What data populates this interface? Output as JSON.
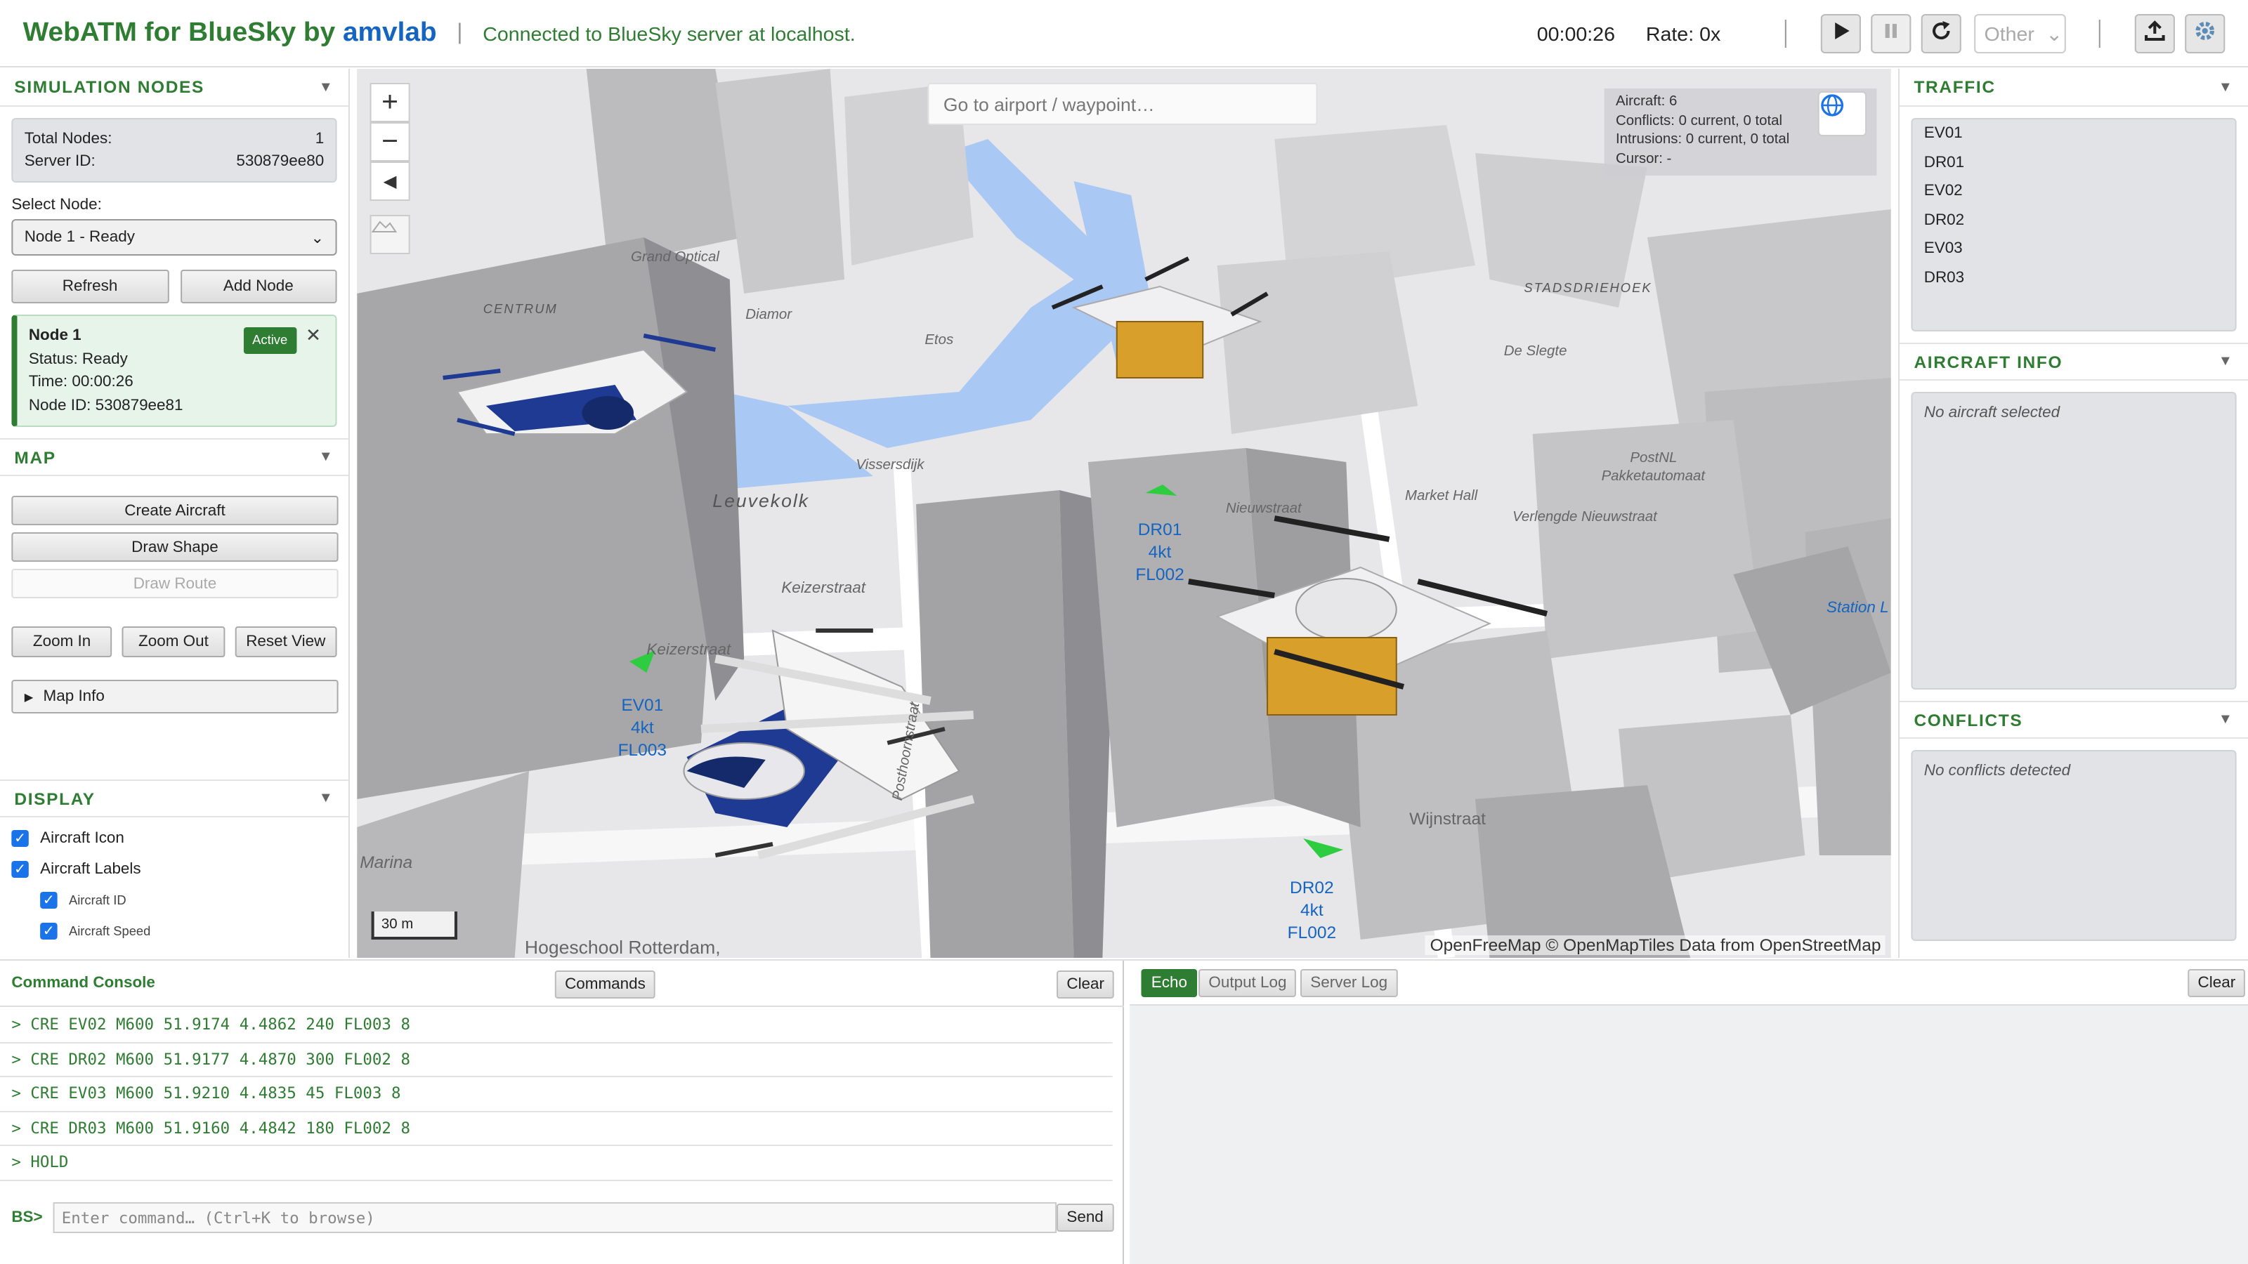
{
  "header": {
    "brand": "WebATM for BlueSky by",
    "brand_highlight": "amvlab",
    "separator": "|",
    "connection": "Connected to BlueSky server at localhost.",
    "sim_time": "00:00:26",
    "rate": "Rate: 0x",
    "other_select": "Other"
  },
  "left": {
    "sim_nodes": {
      "title": "SIMULATION NODES",
      "total_nodes_label": "Total Nodes:",
      "total_nodes": "1",
      "server_id_label": "Server ID:",
      "server_id": "530879ee80",
      "select_label": "Select Node:",
      "selected": "Node 1 - Ready",
      "refresh": "Refresh",
      "add_node": "Add Node",
      "card": {
        "name": "Node 1",
        "badge": "Active",
        "status": "Status: Ready",
        "time": "Time: 00:00:26",
        "node_id": "Node ID: 530879ee81"
      }
    },
    "map": {
      "title": "MAP",
      "create_aircraft": "Create Aircraft",
      "draw_shape": "Draw Shape",
      "draw_route": "Draw Route",
      "zoom_in": "Zoom In",
      "zoom_out": "Zoom Out",
      "reset_view": "Reset View",
      "map_info": "Map Info"
    },
    "display": {
      "title": "DISPLAY",
      "aircraft_icon": "Aircraft Icon",
      "aircraft_labels": "Aircraft Labels",
      "aircraft_id": "Aircraft ID",
      "aircraft_speed": "Aircraft Speed"
    }
  },
  "map": {
    "search_placeholder": "Go to airport / waypoint…",
    "stats": {
      "aircraft": "Aircraft: 6",
      "conflicts": "Conflicts: 0 current, 0 total",
      "intrusions": "Intrusions: 0 current, 0 total",
      "cursor": "Cursor: -"
    },
    "scale": "30 m",
    "attribution": "OpenFreeMap © OpenMapTiles Data from OpenStreetMap",
    "places": {
      "leuvekolk": "Leuvekolk",
      "keizerstraat": "Keizerstraat",
      "keizerstraat2": "Keizerstraat",
      "centrum": "CENTRUM",
      "grand_optical": "Grand Optical",
      "diamor": "Diamor",
      "etos": "Etos",
      "de_slegte": "De Slegte",
      "market_hall": "Market Hall",
      "postnl": "PostNL",
      "postnl2": "Pakketautomaat",
      "stadsdriehoek": "STADSDRIEHOEK",
      "wijnstraat": "Wijnstraat",
      "hogeschool": "Hogeschool Rotterdam,",
      "marina": "Marina",
      "station": "Station L",
      "vissersdijk": "Vissersdijk",
      "nieuwstraat": "Nieuwstraat",
      "verlengde": "Verlengde Nieuwstraat",
      "posthoornstraat": "Posthoornstraat"
    },
    "aircraft": {
      "ev01": {
        "id": "EV01",
        "speed": "4kt",
        "fl": "FL003"
      },
      "dr01": {
        "id": "DR01",
        "speed": "4kt",
        "fl": "FL002"
      },
      "dr02": {
        "id": "DR02",
        "speed": "4kt",
        "fl": "FL002"
      }
    }
  },
  "right": {
    "traffic_title": "TRAFFIC",
    "traffic": [
      "EV01",
      "DR01",
      "EV02",
      "DR02",
      "EV03",
      "DR03"
    ],
    "info_title": "AIRCRAFT INFO",
    "info_empty": "No aircraft selected",
    "conflicts_title": "CONFLICTS",
    "conflicts_empty": "No conflicts detected"
  },
  "console": {
    "title": "Command Console",
    "commands_btn": "Commands",
    "clear_btn": "Clear",
    "lines": [
      "> CRE EV02 M600 51.9174 4.4862 240 FL003 8",
      "> CRE DR02 M600 51.9177 4.4870 300 FL002 8",
      "> CRE EV03 M600 51.9210 4.4835 45 FL003 8",
      "> CRE DR03 M600 51.9160 4.4842 180 FL002 8",
      "> HOLD"
    ],
    "prompt": "BS>",
    "input_placeholder": "Enter command… (Ctrl+K to browse)",
    "send_btn": "Send"
  },
  "logs": {
    "echo": "Echo",
    "output": "Output Log",
    "server": "Server Log",
    "clear": "Clear"
  },
  "colors": {
    "accent": "#2e7d32",
    "link": "#1565c0"
  }
}
